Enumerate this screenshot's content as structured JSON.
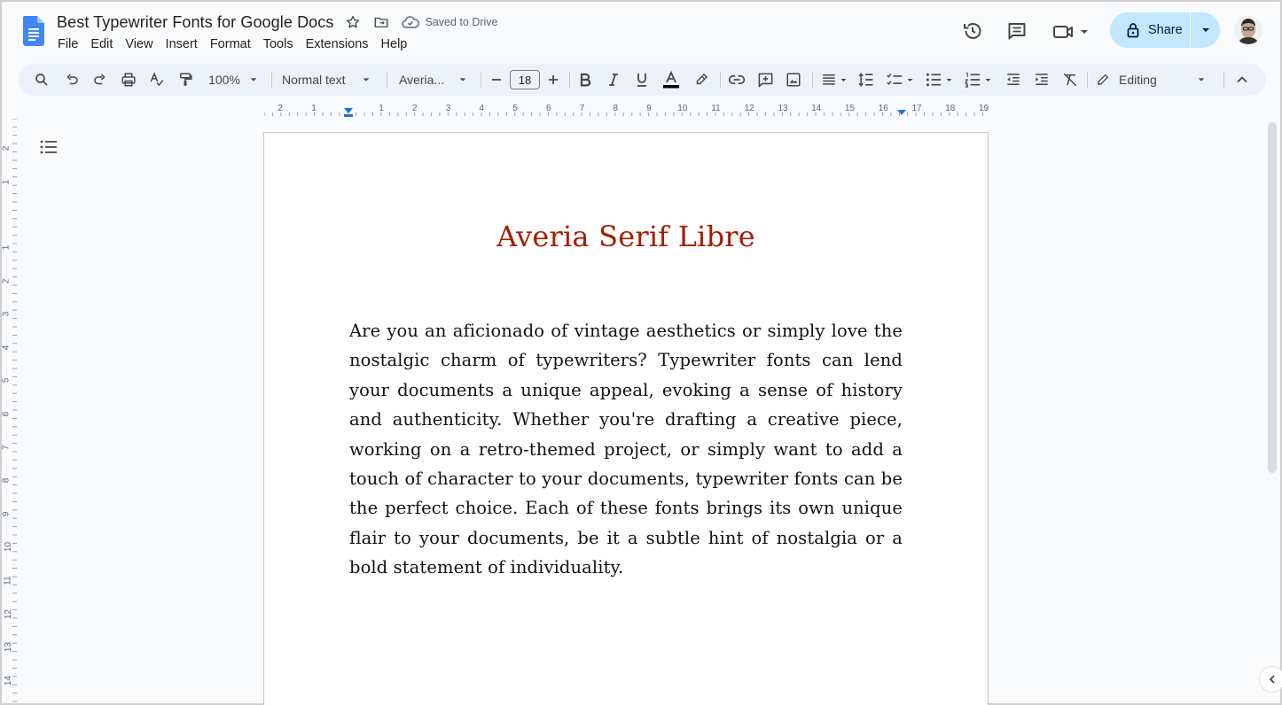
{
  "header": {
    "title": "Best Typewriter Fonts for Google Docs",
    "saved_status": "Saved to Drive",
    "share_label": "Share"
  },
  "menu": [
    "File",
    "Edit",
    "View",
    "Insert",
    "Format",
    "Tools",
    "Extensions",
    "Help"
  ],
  "toolbar": {
    "zoom": "100%",
    "paragraph_style": "Normal text",
    "font": "Averia...",
    "font_size": "18",
    "mode": "Editing"
  },
  "ruler": {
    "horizontal": [
      "2",
      "1",
      "1",
      "2",
      "3",
      "4",
      "5",
      "6",
      "7",
      "8",
      "9",
      "10",
      "11",
      "12",
      "13",
      "14",
      "15",
      "16",
      "17",
      "18",
      "19"
    ],
    "vertical": [
      "2",
      "1",
      "1",
      "2",
      "3",
      "4",
      "5",
      "6",
      "7",
      "8",
      "9",
      "10",
      "11",
      "12",
      "13",
      "14"
    ]
  },
  "document": {
    "heading": "Averia Serif Libre",
    "body": "Are you an aficionado of vintage aesthetics or simply love the nostalgic charm of typewriters? Typewriter fonts can lend your documents a unique appeal, evoking a sense of history and authenticity. Whether you're drafting a creative piece, working on a retro-themed project, or simply want to add a touch of character to your documents, typewriter fonts can be the perfect choice. Each of these fonts brings its own unique flair to your documents, be it a subtle hint of nostalgia or a bold statement of individuality."
  },
  "colors": {
    "heading": "#a61c00",
    "share_bg": "#c2e7ff",
    "toolbar_bg": "#edf2fa",
    "docs_blue": "#4285f4"
  },
  "icons": [
    "docs-logo-icon",
    "star-icon",
    "move-folder-icon",
    "cloud-saved-icon",
    "history-icon",
    "comments-icon",
    "meet-icon",
    "lock-icon",
    "chevron-down-icon",
    "search-icon",
    "undo-icon",
    "redo-icon",
    "print-icon",
    "spellcheck-icon",
    "paint-format-icon",
    "bold-icon",
    "italic-icon",
    "underline-icon",
    "text-color-icon",
    "highlight-icon",
    "link-icon",
    "add-comment-icon",
    "image-icon",
    "align-icon",
    "line-spacing-icon",
    "checklist-icon",
    "bullet-list-icon",
    "numbered-list-icon",
    "indent-decrease-icon",
    "indent-increase-icon",
    "clear-format-icon",
    "pencil-icon",
    "collapse-icon",
    "outline-icon"
  ]
}
